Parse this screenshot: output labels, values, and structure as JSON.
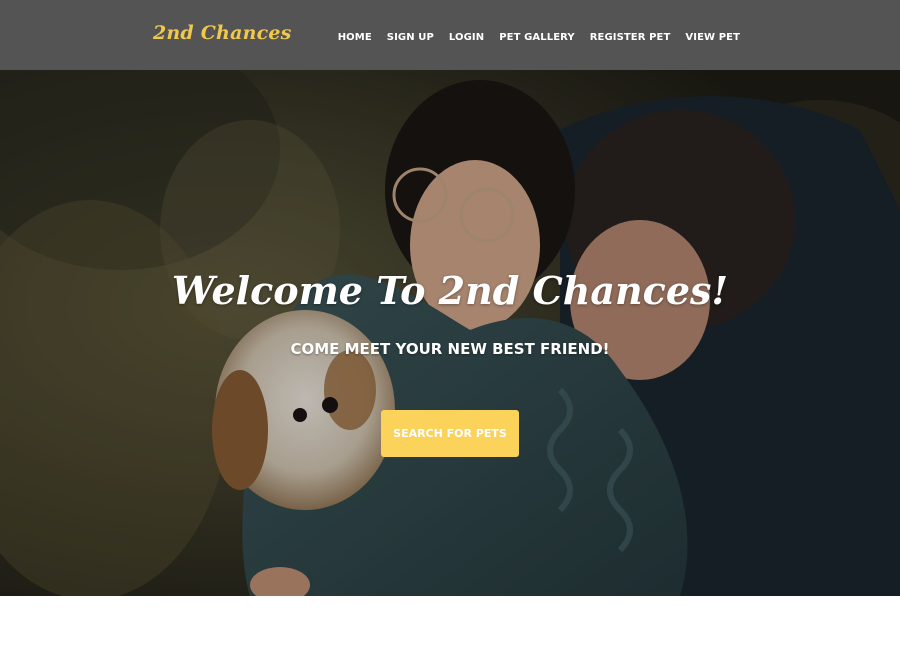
{
  "navbar": {
    "brand": "2nd Chances",
    "links": [
      {
        "label": "HOME"
      },
      {
        "label": "SIGN UP"
      },
      {
        "label": "LOGIN"
      },
      {
        "label": "PET GALLERY"
      },
      {
        "label": "REGISTER PET"
      },
      {
        "label": "VIEW PET"
      }
    ],
    "colors": {
      "background": "#545454",
      "brand": "#f1c84b",
      "link": "#ffffff"
    }
  },
  "hero": {
    "title": "Welcome To 2nd Chances!",
    "subtitle": "COME MEET YOUR NEW BEST FRIEND!",
    "button_label": "SEARCH FOR PETS",
    "image_subject": "couple hugging a small fluffy dog outdoors",
    "colors": {
      "button": "#fbd25a",
      "button_text": "#ffffff",
      "text": "#ffffff"
    }
  }
}
